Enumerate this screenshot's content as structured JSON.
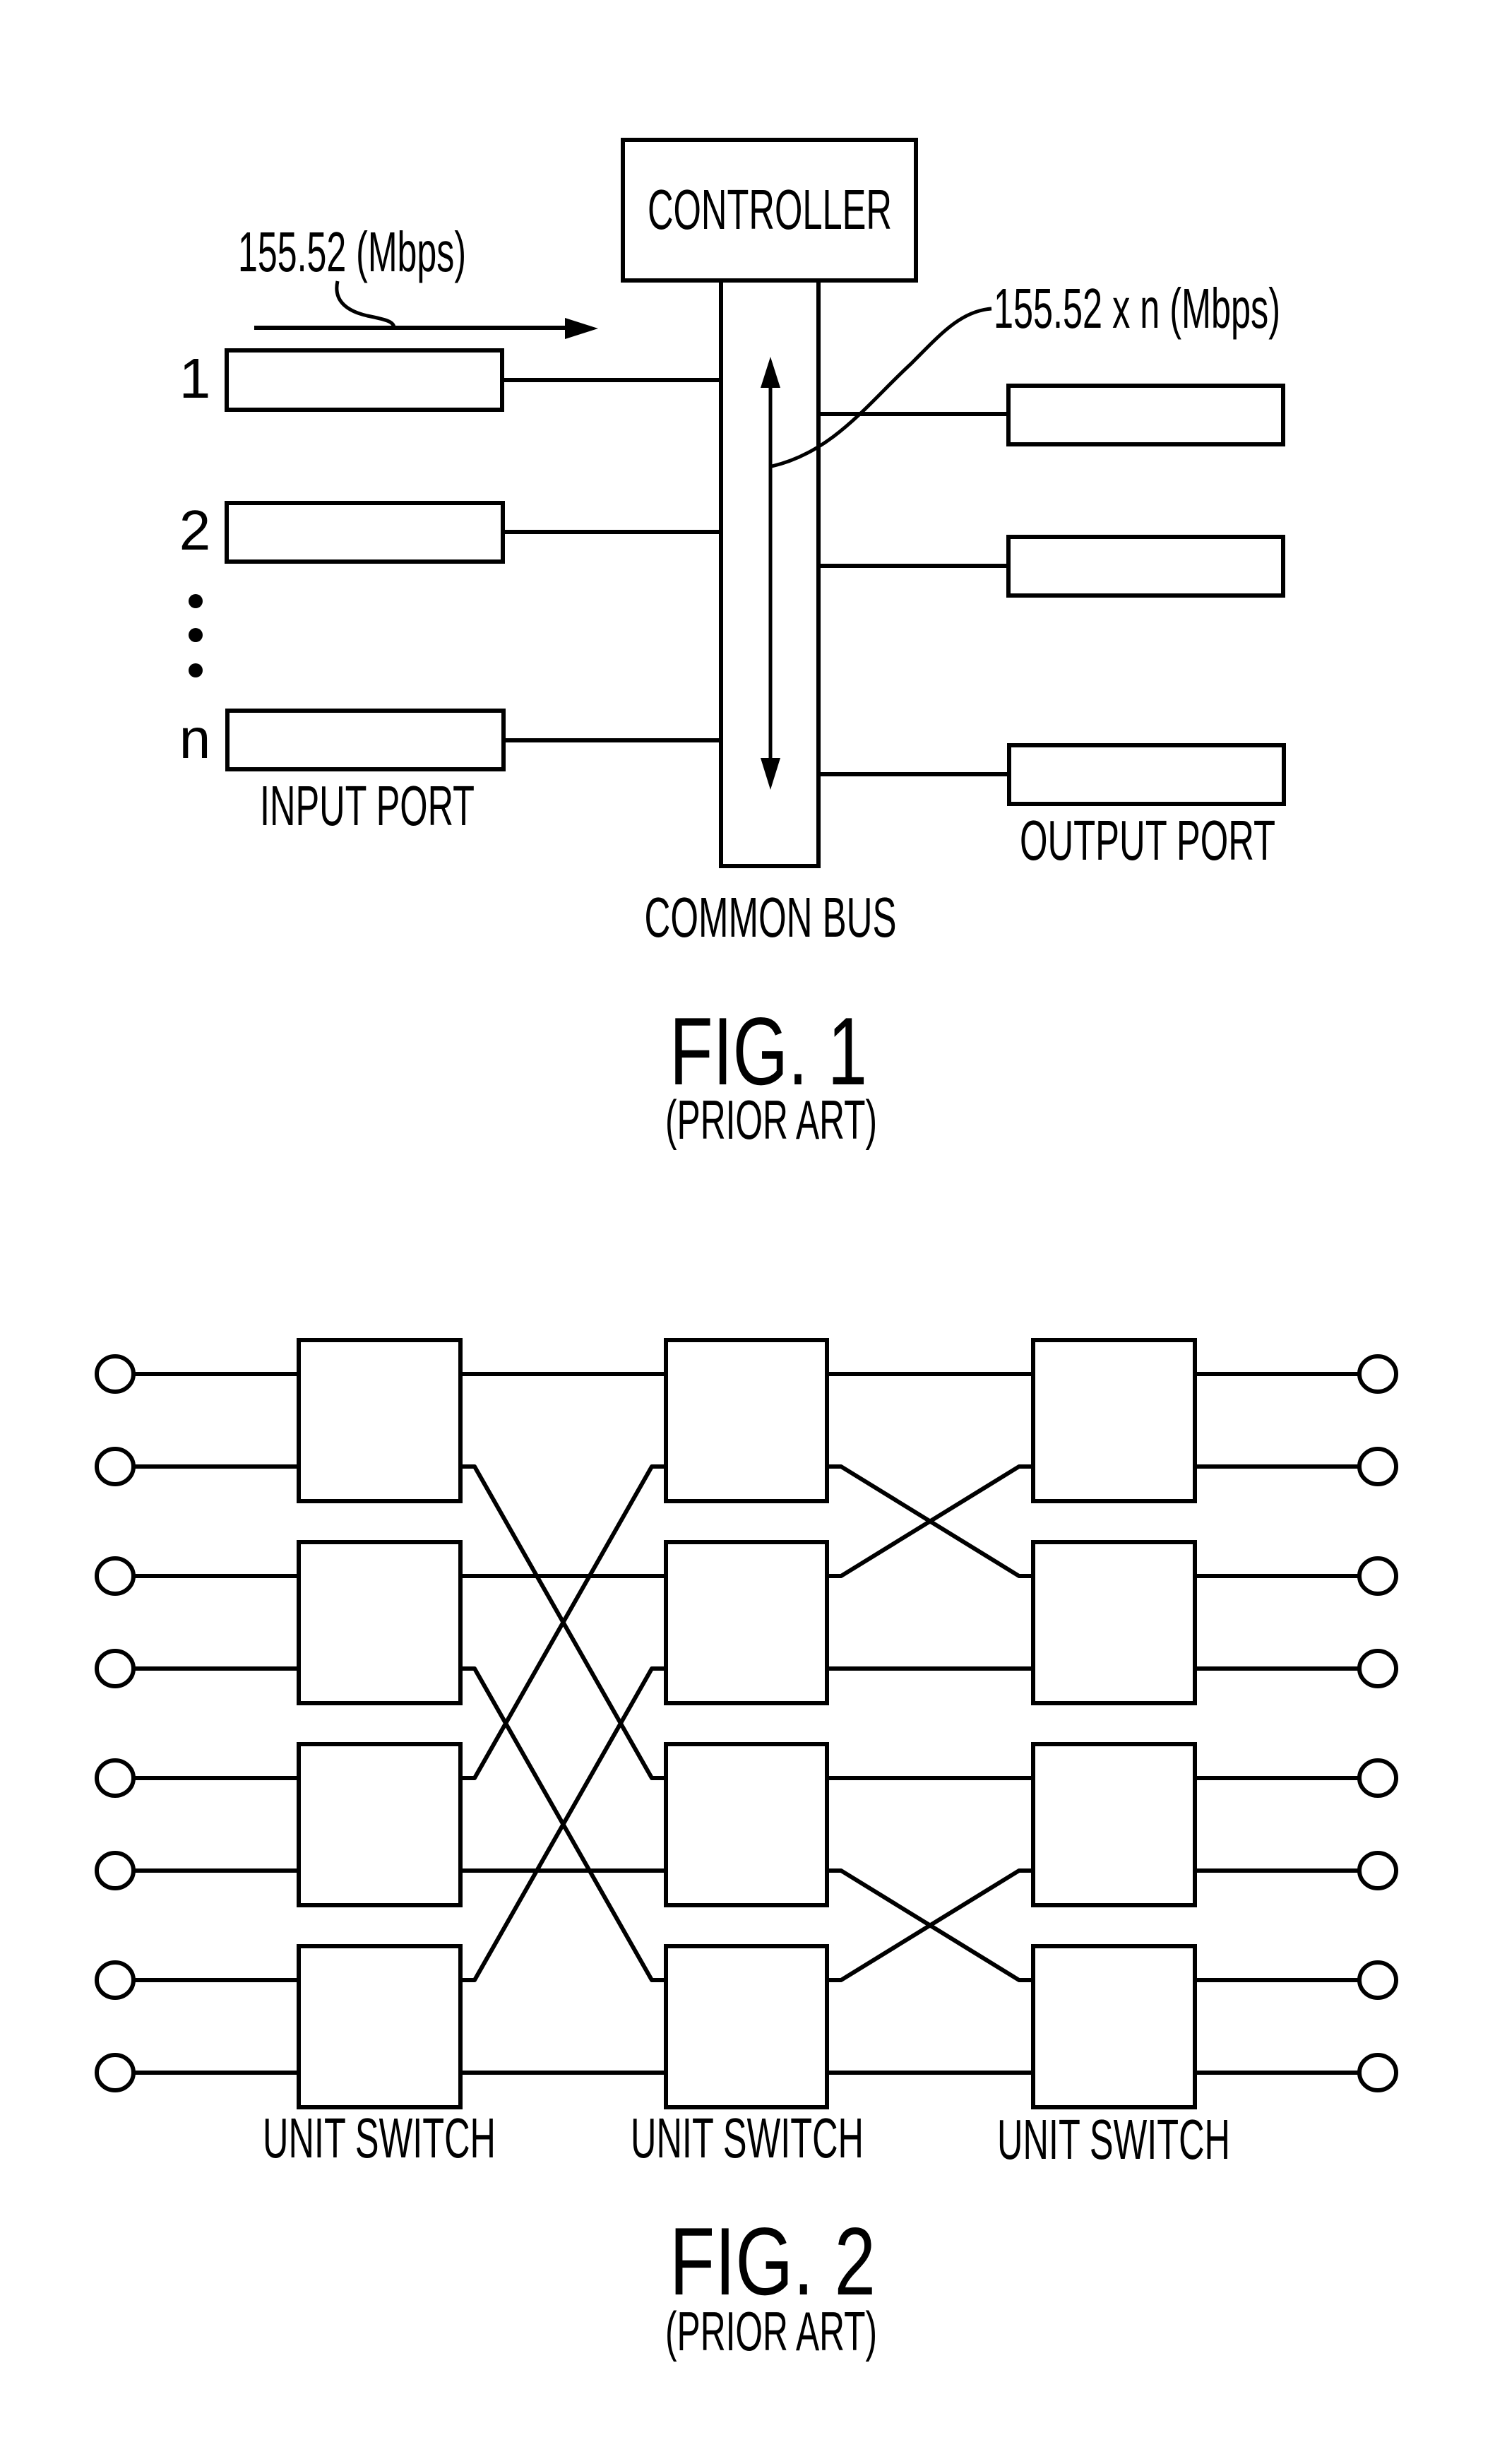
{
  "figure1": {
    "title": "FIG. 1",
    "subtitle": "(PRIOR ART)",
    "controller_label": "CONTROLLER",
    "input_rate_label": "155.52 (Mbps)",
    "bus_rate_label": "155.52 x n (Mbps)",
    "input_port_label": "INPUT PORT",
    "output_port_label": "OUTPUT PORT",
    "common_bus_label": "COMMON BUS",
    "input_ports": [
      {
        "label": "1"
      },
      {
        "label": "2"
      },
      {
        "label": "n"
      }
    ],
    "ellipsis_dots": 3,
    "output_ports": 3
  },
  "figure2": {
    "title": "FIG. 2",
    "subtitle": "(PRIOR ART)",
    "stage_labels": [
      "UNIT SWITCH",
      "UNIT SWITCH",
      "UNIT SWITCH"
    ],
    "inputs": 8,
    "outputs": 8,
    "switches_per_stage": 4,
    "stage1_to_stage2": [
      [
        0,
        0
      ],
      [
        1,
        4
      ],
      [
        2,
        2
      ],
      [
        3,
        6
      ],
      [
        4,
        1
      ],
      [
        5,
        5
      ],
      [
        6,
        3
      ],
      [
        7,
        7
      ]
    ],
    "stage2_to_stage3": [
      [
        0,
        0
      ],
      [
        1,
        2
      ],
      [
        2,
        1
      ],
      [
        3,
        3
      ],
      [
        4,
        4
      ],
      [
        5,
        6
      ],
      [
        6,
        5
      ],
      [
        7,
        7
      ]
    ]
  },
  "colors": {
    "ink": "#000000",
    "paper": "#ffffff"
  }
}
